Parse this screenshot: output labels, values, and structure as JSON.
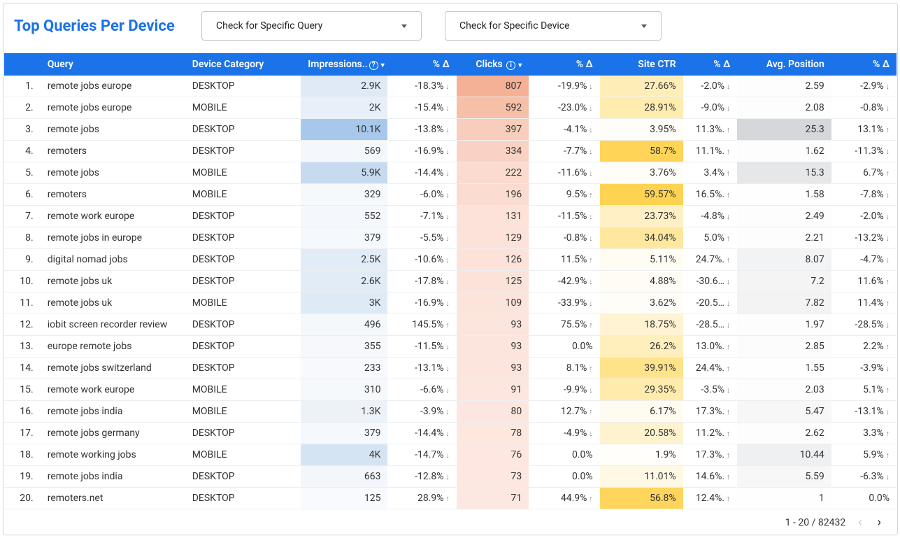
{
  "title": "Top Queries Per Device",
  "dropdown1": "Check for Specific Query",
  "dropdown2": "Check for Specific Device",
  "headers": {
    "index": "",
    "query": "Query",
    "device": "Device Category",
    "impressions": "Impressions..",
    "imp_delta": "% Δ",
    "clicks": "Clicks",
    "clicks_delta": "% Δ",
    "ctr": "Site CTR",
    "ctr_delta": "% Δ",
    "position": "Avg. Position",
    "pos_delta": "% Δ"
  },
  "pager": {
    "range": "1 - 20 / 82432"
  },
  "rows": [
    {
      "i": "1.",
      "q": "remote jobs europe",
      "d": "DESKTOP",
      "imp": "2.9K",
      "impc": "#dfeaf6",
      "impd": "-18.3%",
      "impdir": "down",
      "cl": "807",
      "clc": "#f4b196",
      "cld": "-19.9%",
      "cldir": "down",
      "ctr": "27.66%",
      "ctrc": "#ffeeb8",
      "ctrd": "-2.0%",
      "ctrdir": "down",
      "pos": "2.59",
      "posc": "#fdfdfd",
      "posd": "-2.9%",
      "posdir": "down"
    },
    {
      "i": "2.",
      "q": "remote jobs europe",
      "d": "MOBILE",
      "imp": "2K",
      "impc": "#e7eff9",
      "impd": "-15.4%",
      "impdir": "down",
      "cl": "592",
      "clc": "#f6bfa8",
      "cld": "-23.0%",
      "cldir": "down",
      "ctr": "28.91%",
      "ctrc": "#ffecaf",
      "ctrd": "-9.0%",
      "ctrdir": "down",
      "pos": "2.08",
      "posc": "#fdfdfd",
      "posd": "-0.8%",
      "posdir": "down"
    },
    {
      "i": "3.",
      "q": "remote jobs",
      "d": "DESKTOP",
      "imp": "10.1K",
      "impc": "#a7c8ec",
      "impd": "-13.8%",
      "impdir": "down",
      "cl": "397",
      "clc": "#f9cdbc",
      "cld": "-4.1%",
      "cldir": "down",
      "ctr": "3.95%",
      "ctrc": "#fffdf7",
      "ctrd": "11.3%.",
      "ctrdir": "up",
      "pos": "25.3",
      "posc": "#d6d7da",
      "posd": "13.1%",
      "posdir": "up"
    },
    {
      "i": "4.",
      "q": "remoters",
      "d": "DESKTOP",
      "imp": "569",
      "impc": "#f4f7fb",
      "impd": "-16.9%",
      "impdir": "down",
      "cl": "334",
      "clc": "#fad2c3",
      "cld": "-7.7%",
      "cldir": "down",
      "ctr": "58.7%",
      "ctrc": "#ffd457",
      "ctrd": "11.1%.",
      "ctrdir": "up",
      "pos": "1.62",
      "posc": "#fdfdfd",
      "posd": "-11.3%",
      "posdir": "down"
    },
    {
      "i": "5.",
      "q": "remote jobs",
      "d": "MOBILE",
      "imp": "5.9K",
      "impc": "#c6dbf0",
      "impd": "-14.4%",
      "impdir": "down",
      "cl": "222",
      "clc": "#fbdbce",
      "cld": "-11.6%",
      "cldir": "down",
      "ctr": "3.76%",
      "ctrc": "#fffdf8",
      "ctrd": "3.4%",
      "ctrdir": "up",
      "pos": "15.3",
      "posc": "#e6e7e9",
      "posd": "6.7%",
      "posdir": "up"
    },
    {
      "i": "6.",
      "q": "remoters",
      "d": "MOBILE",
      "imp": "329",
      "impc": "#f6f9fc",
      "impd": "-6.0%",
      "impdir": "down",
      "cl": "196",
      "clc": "#fbdcd0",
      "cld": "9.5%",
      "cldir": "up",
      "ctr": "59.57%",
      "ctrc": "#ffd352",
      "ctrd": "16.5%.",
      "ctrdir": "up",
      "pos": "1.58",
      "posc": "#fefefe",
      "posd": "-7.8%",
      "posdir": "down"
    },
    {
      "i": "7.",
      "q": "remote work europe",
      "d": "DESKTOP",
      "imp": "552",
      "impc": "#f4f7fb",
      "impd": "-7.1%",
      "impdir": "down",
      "cl": "131",
      "clc": "#fce2d8",
      "cld": "-11.5%",
      "cldir": "down",
      "ctr": "23.73%",
      "ctrc": "#fff0c5",
      "ctrd": "-4.8%",
      "ctrdir": "down",
      "pos": "2.49",
      "posc": "#fdfdfd",
      "posd": "-2.0%",
      "posdir": "down"
    },
    {
      "i": "8.",
      "q": "remote jobs in europe",
      "d": "DESKTOP",
      "imp": "379",
      "impc": "#f5f8fc",
      "impd": "-5.5%",
      "impdir": "down",
      "cl": "129",
      "clc": "#fce2d8",
      "cld": "-0.8%",
      "cldir": "down",
      "ctr": "34.04%",
      "ctrc": "#ffe89e",
      "ctrd": "5.0%",
      "ctrdir": "up",
      "pos": "2.21",
      "posc": "#fdfdfd",
      "posd": "-13.2%",
      "posdir": "down"
    },
    {
      "i": "9.",
      "q": "digital nomad jobs",
      "d": "DESKTOP",
      "imp": "2.5K",
      "impc": "#e2ecf7",
      "impd": "-10.6%",
      "impdir": "down",
      "cl": "126",
      "clc": "#fce2d9",
      "cld": "11.5%",
      "cldir": "up",
      "ctr": "5.11%",
      "ctrc": "#fffcf4",
      "ctrd": "24.7%.",
      "ctrdir": "up",
      "pos": "8.07",
      "posc": "#f2f3f4",
      "posd": "-4.7%",
      "posdir": "down"
    },
    {
      "i": "10.",
      "q": "remote jobs uk",
      "d": "DESKTOP",
      "imp": "2.6K",
      "impc": "#e1ecf7",
      "impd": "-17.8%",
      "impdir": "down",
      "cl": "125",
      "clc": "#fce3d9",
      "cld": "-42.9%",
      "cldir": "down",
      "ctr": "4.88%",
      "ctrc": "#fffcf5",
      "ctrd": "-30.6…",
      "ctrdir": "down",
      "pos": "7.2",
      "posc": "#f4f4f5",
      "posd": "11.6%",
      "posdir": "up"
    },
    {
      "i": "11.",
      "q": "remote jobs uk",
      "d": "MOBILE",
      "imp": "3K",
      "impc": "#deebf6",
      "impd": "-16.9%",
      "impdir": "down",
      "cl": "109",
      "clc": "#fce4db",
      "cld": "-33.9%",
      "cldir": "down",
      "ctr": "3.62%",
      "ctrc": "#fffdf8",
      "ctrd": "-20.5…",
      "ctrdir": "down",
      "pos": "7.82",
      "posc": "#f3f3f4",
      "posd": "11.4%",
      "posdir": "up"
    },
    {
      "i": "12.",
      "q": "iobit screen recorder review",
      "d": "DESKTOP",
      "imp": "496",
      "impc": "#f4f8fb",
      "impd": "145.5%",
      "impdir": "up",
      "cl": "93",
      "clc": "#fce5dd",
      "cld": "75.5%",
      "cldir": "up",
      "ctr": "18.75%",
      "ctrc": "#fff3d4",
      "ctrd": "-28.5…",
      "ctrdir": "down",
      "pos": "1.97",
      "posc": "#fdfdfd",
      "posd": "-28.5%",
      "posdir": "down"
    },
    {
      "i": "13.",
      "q": "europe remote jobs",
      "d": "DESKTOP",
      "imp": "355",
      "impc": "#f6f8fc",
      "impd": "-11.5%",
      "impdir": "down",
      "cl": "93",
      "clc": "#fce5dd",
      "cld": "0.0%",
      "cldir": "",
      "ctr": "26.2%",
      "ctrc": "#ffefbd",
      "ctrd": "13.0%.",
      "ctrdir": "up",
      "pos": "2.85",
      "posc": "#fcfcfd",
      "posd": "2.2%",
      "posdir": "up"
    },
    {
      "i": "14.",
      "q": "remote jobs switzerland",
      "d": "DESKTOP",
      "imp": "233",
      "impc": "#f7f9fc",
      "impd": "-13.1%",
      "impdir": "down",
      "cl": "93",
      "clc": "#fce5dd",
      "cld": "8.1%",
      "cldir": "up",
      "ctr": "39.91%",
      "ctrc": "#ffe38b",
      "ctrd": "24.4%.",
      "ctrdir": "up",
      "pos": "1.55",
      "posc": "#fefefe",
      "posd": "-3.9%",
      "posdir": "down"
    },
    {
      "i": "15.",
      "q": "remote work europe",
      "d": "MOBILE",
      "imp": "310",
      "impc": "#f6f9fc",
      "impd": "-6.6%",
      "impdir": "down",
      "cl": "91",
      "clc": "#fce6dd",
      "cld": "-9.9%",
      "cldir": "down",
      "ctr": "29.35%",
      "ctrc": "#ffecad",
      "ctrd": "-3.5%",
      "ctrdir": "down",
      "pos": "2.03",
      "posc": "#fdfdfd",
      "posd": "5.1%",
      "posdir": "up"
    },
    {
      "i": "16.",
      "q": "remote jobs india",
      "d": "MOBILE",
      "imp": "1.3K",
      "impc": "#edf2f9",
      "impd": "-3.9%",
      "impdir": "down",
      "cl": "80",
      "clc": "#fde6df",
      "cld": "12.7%",
      "cldir": "up",
      "ctr": "6.17%",
      "ctrc": "#fffbf1",
      "ctrd": "17.3%.",
      "ctrdir": "up",
      "pos": "5.47",
      "posc": "#f7f7f8",
      "posd": "-13.1%",
      "posdir": "down"
    },
    {
      "i": "17.",
      "q": "remote jobs germany",
      "d": "DESKTOP",
      "imp": "379",
      "impc": "#f5f8fc",
      "impd": "-14.4%",
      "impdir": "down",
      "cl": "78",
      "clc": "#fde7df",
      "cld": "-4.9%",
      "cldir": "down",
      "ctr": "20.58%",
      "ctrc": "#fff2ce",
      "ctrd": "11.2%.",
      "ctrdir": "up",
      "pos": "2.62",
      "posc": "#fdfdfd",
      "posd": "3.3%",
      "posdir": "up"
    },
    {
      "i": "18.",
      "q": "remote working jobs",
      "d": "MOBILE",
      "imp": "4K",
      "impc": "#d5e4f3",
      "impd": "-14.7%",
      "impdir": "down",
      "cl": "76",
      "clc": "#fde7e0",
      "cld": "0.0%",
      "cldir": "",
      "ctr": "1.9%",
      "ctrc": "#fffefb",
      "ctrd": "17.3%.",
      "ctrdir": "up",
      "pos": "10.44",
      "posc": "#eff0f1",
      "posd": "5.9%",
      "posdir": "up"
    },
    {
      "i": "19.",
      "q": "remote jobs india",
      "d": "DESKTOP",
      "imp": "663",
      "impc": "#f3f7fb",
      "impd": "-12.8%",
      "impdir": "down",
      "cl": "73",
      "clc": "#fde7e0",
      "cld": "0.0%",
      "cldir": "",
      "ctr": "11.01%",
      "ctrc": "#fff8e4",
      "ctrd": "14.6%.",
      "ctrdir": "up",
      "pos": "5.59",
      "posc": "#f7f7f8",
      "posd": "-6.3%",
      "posdir": "down"
    },
    {
      "i": "20.",
      "q": "remoters.net",
      "d": "DESKTOP",
      "imp": "125",
      "impc": "#f8fafd",
      "impd": "28.9%",
      "impdir": "up",
      "cl": "71",
      "clc": "#fde8e1",
      "cld": "44.9%",
      "cldir": "up",
      "ctr": "56.8%",
      "ctrc": "#ffd55d",
      "ctrd": "12.4%.",
      "ctrdir": "up",
      "pos": "1",
      "posc": "#fefefe",
      "posd": "0.0%",
      "posdir": ""
    }
  ]
}
